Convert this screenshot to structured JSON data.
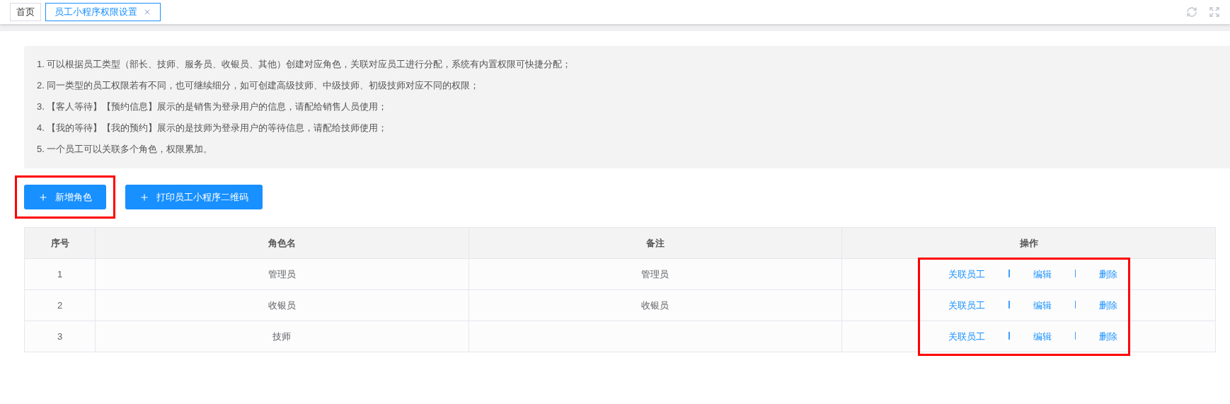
{
  "tabs": [
    {
      "label": "首页",
      "selected": false,
      "closable": false
    },
    {
      "label": "员工小程序权限设置",
      "selected": true,
      "closable": true
    }
  ],
  "notes": [
    "1. 可以根据员工类型（部长、技师、服务员、收银员、其他）创建对应角色，关联对应员工进行分配，系统有内置权限可快捷分配；",
    "2. 同一类型的员工权限若有不同，也可继续细分，如可创建高级技师、中级技师、初级技师对应不同的权限；",
    "3. 【客人等待】【预约信息】展示的是销售为登录用户的信息，请配给销售人员使用；",
    "4. 【我的等待】【我的预约】展示的是技师为登录用户的等待信息，请配给技师使用；",
    "5. 一个员工可以关联多个角色，权限累加。"
  ],
  "buttons": [
    {
      "label": "新增角色",
      "highlighted": true
    },
    {
      "label": "打印员工小程序二维码",
      "highlighted": false
    }
  ],
  "table": {
    "columns": [
      "序号",
      "角色名",
      "备注",
      "操作"
    ],
    "actions_highlighted": true,
    "rows": [
      {
        "index": "1",
        "name": "管理员",
        "note": "管理员",
        "actions": [
          "关联员工",
          "编辑",
          "删除"
        ]
      },
      {
        "index": "2",
        "name": "收银员",
        "note": "收银员",
        "actions": [
          "关联员工",
          "编辑",
          "删除"
        ]
      },
      {
        "index": "3",
        "name": "技师",
        "actions": [
          "关联员工",
          "编辑",
          "删除"
        ]
      }
    ]
  }
}
